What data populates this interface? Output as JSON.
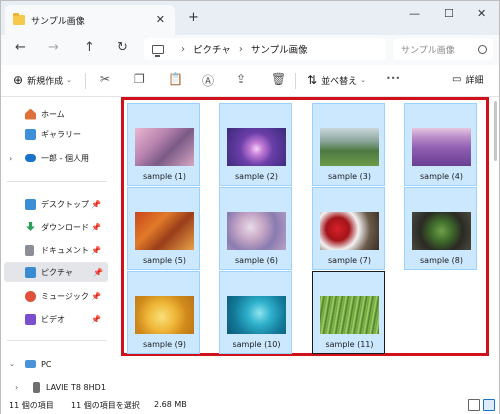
{
  "titlebar": {
    "tab_title": "サンプル画像",
    "close_glyph": "✕",
    "add_glyph": "+",
    "minimize_glyph": "—",
    "maximize_glyph": "☐",
    "window_close_glyph": "✕"
  },
  "nav": {
    "back": "←",
    "forward": "→",
    "up": "↑",
    "refresh": "↻"
  },
  "address": {
    "crumbs": [
      "ピクチャ",
      "サンプル画像"
    ],
    "separator": "›"
  },
  "search": {
    "placeholder": "サンプル画像"
  },
  "commands": {
    "new_label": "新規作成",
    "new_icon": "⊕",
    "sort_label": "並べ替え",
    "sort_icon": "⇅",
    "more": "•••",
    "details_label": "詳細"
  },
  "sidebar": {
    "items": [
      {
        "label": "ホーム",
        "icon": "home-icon"
      },
      {
        "label": "ギャラリー",
        "icon": "gallery-icon"
      },
      {
        "label": "一郎 - 個人用",
        "icon": "onedrive-icon"
      },
      {
        "label": "デスクトップ",
        "icon": "desktop-icon"
      },
      {
        "label": "ダウンロード",
        "icon": "download-icon"
      },
      {
        "label": "ドキュメント",
        "icon": "documents-icon"
      },
      {
        "label": "ピクチャ",
        "icon": "pictures-icon"
      },
      {
        "label": "ミュージック",
        "icon": "music-icon"
      },
      {
        "label": "ビデオ",
        "icon": "video-icon"
      },
      {
        "label": "PC",
        "icon": "pc-icon"
      },
      {
        "label": "LAVIE T8 8HD1",
        "icon": "device-icon"
      }
    ]
  },
  "files": [
    {
      "name": "sample (1)"
    },
    {
      "name": "sample (2)"
    },
    {
      "name": "sample (3)"
    },
    {
      "name": "sample (4)"
    },
    {
      "name": "sample (5)"
    },
    {
      "name": "sample (6)"
    },
    {
      "name": "sample (7)"
    },
    {
      "name": "sample (8)"
    },
    {
      "name": "sample (9)"
    },
    {
      "name": "sample (10)"
    },
    {
      "name": "sample (11)"
    }
  ],
  "status": {
    "item_count": "11 個の項目",
    "selected": "11 個の項目を選択",
    "size": "2.68 MB"
  },
  "colors": {
    "selection_fill": "#cce8ff",
    "selection_border": "#99d1ff",
    "highlight_frame": "#d0111b"
  }
}
